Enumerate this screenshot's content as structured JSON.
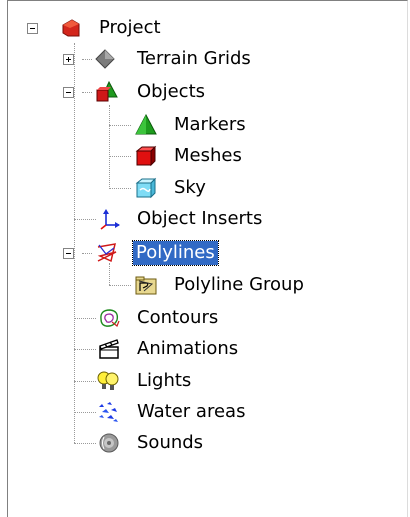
{
  "tree": {
    "root": {
      "label": "Project",
      "icon": "project-icon",
      "expanded": true
    },
    "terrain_grids": {
      "label": "Terrain Grids",
      "icon": "diamond-icon",
      "expanded": false
    },
    "objects": {
      "label": "Objects",
      "icon": "objects-icon",
      "expanded": true
    },
    "markers": {
      "label": "Markers",
      "icon": "green-cone-icon"
    },
    "meshes": {
      "label": "Meshes",
      "icon": "red-cube-icon"
    },
    "sky": {
      "label": "Sky",
      "icon": "cyan-cube-icon"
    },
    "object_inserts": {
      "label": "Object Inserts",
      "icon": "axes-icon"
    },
    "polylines": {
      "label": "Polylines",
      "icon": "polyline-icon",
      "expanded": true,
      "selected": true
    },
    "polyline_group": {
      "label": "Polyline Group",
      "icon": "folder-icon"
    },
    "contours": {
      "label": "Contours",
      "icon": "contours-icon"
    },
    "animations": {
      "label": "Animations",
      "icon": "clapper-icon"
    },
    "lights": {
      "label": "Lights",
      "icon": "bulb-icon"
    },
    "water_areas": {
      "label": "Water areas",
      "icon": "water-icon"
    },
    "sounds": {
      "label": "Sounds",
      "icon": "speaker-icon"
    }
  },
  "colors": {
    "selection": "#316ac5",
    "tree_line": "#9a9a9a"
  }
}
